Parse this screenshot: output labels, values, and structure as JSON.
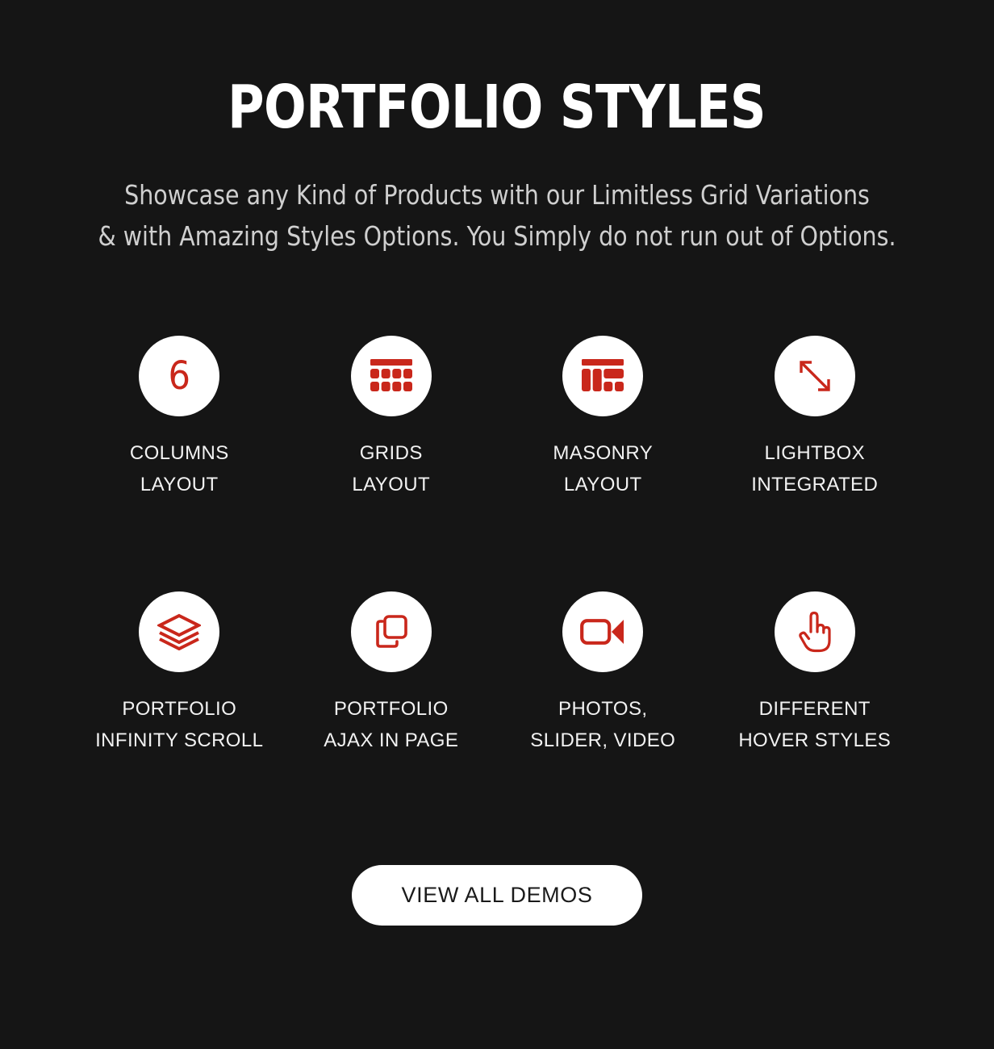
{
  "section": {
    "title": "PORTFOLIO STYLES",
    "subtitle_line1": "Showcase any Kind of Products with our Limitless Grid Variations",
    "subtitle_line2": "& with Amazing Styles Options. You Simply do not run out of Options."
  },
  "colors": {
    "background": "#151515",
    "accent_red": "#c9271b",
    "badge_background": "#ffffff",
    "title_text": "#ffffff",
    "subtitle_text": "#cfcfcf",
    "label_text": "#f2f2f2",
    "cta_background": "#ffffff",
    "cta_text": "#1a1a1a"
  },
  "features": [
    {
      "icon": "number-six-icon",
      "icon_value": "6",
      "label_line1": "COLUMNS",
      "label_line2": "LAYOUT"
    },
    {
      "icon": "grids-layout-icon",
      "label_line1": "GRIDS",
      "label_line2": "LAYOUT"
    },
    {
      "icon": "masonry-layout-icon",
      "label_line1": "MASONRY",
      "label_line2": "LAYOUT"
    },
    {
      "icon": "expand-arrows-icon",
      "label_line1": "LIGHTBOX",
      "label_line2": "INTEGRATED"
    },
    {
      "icon": "layers-stack-icon",
      "label_line1": "PORTFOLIO",
      "label_line2": "INFINITY SCROLL"
    },
    {
      "icon": "copy-squares-icon",
      "label_line1": "PORTFOLIO",
      "label_line2": "AJAX IN PAGE"
    },
    {
      "icon": "video-camera-icon",
      "label_line1": "PHOTOS,",
      "label_line2": "SLIDER, VIDEO"
    },
    {
      "icon": "pointing-hand-icon",
      "label_line1": "DIFFERENT",
      "label_line2": "HOVER STYLES"
    }
  ],
  "cta": {
    "label": "VIEW ALL DEMOS"
  }
}
